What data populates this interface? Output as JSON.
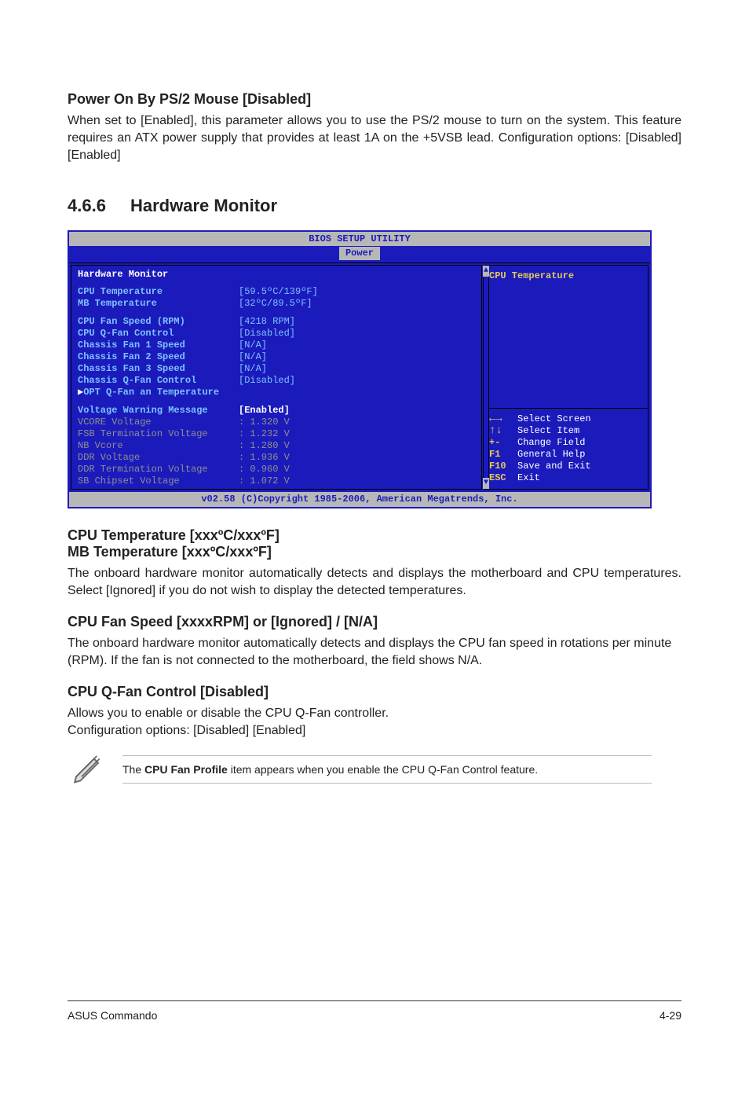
{
  "section1": {
    "title": "Power On By PS/2 Mouse [Disabled]",
    "body": "When set to [Enabled], this parameter allows you to use the PS/2 mouse to turn on the system. This feature requires an ATX power supply that provides at least 1A on the +5VSB lead. Configuration options: [Disabled] [Enabled]"
  },
  "section2": {
    "num": "4.6.6",
    "title": "Hardware Monitor"
  },
  "bios": {
    "title": "BIOS SETUP UTILITY",
    "tab": "Power",
    "panel_heading": "Hardware Monitor",
    "rows_a": [
      {
        "label": "CPU Temperature",
        "value": "[59.5ºC/139ºF]"
      },
      {
        "label": "MB Temperature",
        "value": "[32ºC/89.5ºF]"
      }
    ],
    "rows_b": [
      {
        "label": "CPU Fan Speed (RPM)",
        "value": "[4218 RPM]"
      },
      {
        "label": "CPU Q-Fan Control",
        "value": "[Disabled]"
      },
      {
        "label": "Chassis Fan 1 Speed",
        "value": "[N/A]"
      },
      {
        "label": "Chassis Fan 2 Speed",
        "value": "[N/A]"
      },
      {
        "label": "Chassis Fan 3 Speed",
        "value": "[N/A]"
      },
      {
        "label": "Chassis Q-Fan Control",
        "value": "[Disabled]"
      }
    ],
    "sub_item": "OPT Q-Fan an Temperature",
    "rows_c": [
      {
        "label": "Voltage Warning Message",
        "value": "[Enabled]",
        "white": true
      },
      {
        "label": "VCORE Voltage",
        "value": ": 1.320 V",
        "gray": true
      },
      {
        "label": "FSB Termination Voltage",
        "value": ": 1.232 V",
        "gray": true
      },
      {
        "label": "NB Vcore",
        "value": ": 1.280 V",
        "gray": true
      },
      {
        "label": "DDR Voltage",
        "value": ": 1.936 V",
        "gray": true
      },
      {
        "label": "DDR Termination Voltage",
        "value": ": 0.960 V",
        "gray": true
      },
      {
        "label": "SB Chipset Voltage",
        "value": ": 1.072 V",
        "gray": true
      }
    ],
    "help": "CPU Temperature",
    "keys": [
      {
        "k": "←→",
        "d": "Select Screen",
        "arrow": true
      },
      {
        "k": "↑↓",
        "d": "Select Item",
        "arrow": true
      },
      {
        "k": "+-",
        "d": "Change Field"
      },
      {
        "k": "F1",
        "d": "General Help"
      },
      {
        "k": "F10",
        "d": "Save and Exit"
      },
      {
        "k": "ESC",
        "d": "Exit"
      }
    ],
    "footer": "v02.58 (C)Copyright 1985-2006, American Megatrends, Inc."
  },
  "section3": {
    "h1": "CPU Temperature [xxxºC/xxxºF]",
    "h2": "MB Temperature [xxxºC/xxxºF]",
    "body": "The onboard hardware monitor automatically detects and displays the motherboard and CPU temperatures. Select [Ignored] if you do not wish to display the detected temperatures."
  },
  "section4": {
    "h": "CPU Fan Speed [xxxxRPM] or [Ignored] / [N/A]",
    "body": "The onboard hardware monitor automatically detects and displays the CPU fan speed in rotations per minute (RPM). If the fan is not connected to the motherboard, the field shows N/A."
  },
  "section5": {
    "h": "CPU Q-Fan Control [Disabled]",
    "body1": "Allows you to enable or disable the CPU Q-Fan controller.",
    "body2": "Configuration options: [Disabled] [Enabled]"
  },
  "note": {
    "pre": "The ",
    "bold": "CPU Fan Profile",
    "post": " item appears when you enable the CPU Q-Fan Control feature."
  },
  "footer": {
    "left": "ASUS Commando",
    "right": "4-29"
  }
}
